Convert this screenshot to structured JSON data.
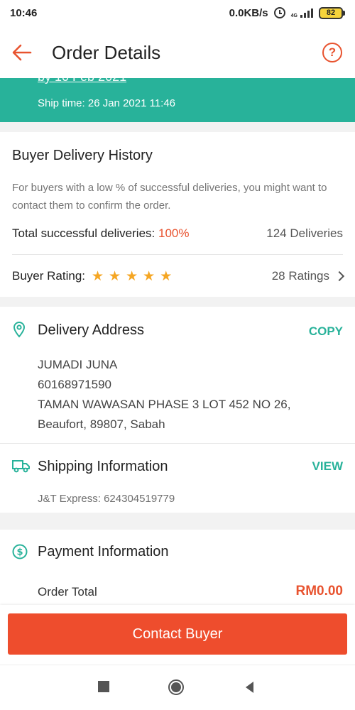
{
  "status": {
    "time": "10:46",
    "speed": "0.0KB/s",
    "network": "4G",
    "battery": "82"
  },
  "appbar": {
    "title": "Order Details",
    "help": "?"
  },
  "banner": {
    "partial_text": "by 10 Feb 2021",
    "ship_time": "Ship time: 26 Jan 2021 11:46"
  },
  "buyer_history": {
    "title": "Buyer Delivery History",
    "description": "For buyers with a low % of successful deliveries, you might want to contact them to confirm the order.",
    "success_label": "Total successful deliveries:",
    "success_pct": "100%",
    "deliveries": "124 Deliveries",
    "rating_label": "Buyer Rating:",
    "rating_stars": 5,
    "ratings_count": "28 Ratings"
  },
  "delivery_address": {
    "title": "Delivery Address",
    "action": "COPY",
    "lines": [
      "JUMADI JUNA",
      "60168971590",
      "TAMAN WAWASAN PHASE 3 LOT 452 NO 26,",
      "Beaufort, 89807, Sabah"
    ]
  },
  "shipping": {
    "title": "Shipping Information",
    "action": "VIEW",
    "tracking": "J&T Express: 624304519779"
  },
  "payment": {
    "title": "Payment Information",
    "order_total_label": "Order Total",
    "order_total_value": "RM0.00"
  },
  "cta": {
    "label": "Contact Buyer"
  },
  "colors": {
    "accent": "#ee4d2d",
    "teal": "#28b29a",
    "star": "#f5a623"
  }
}
